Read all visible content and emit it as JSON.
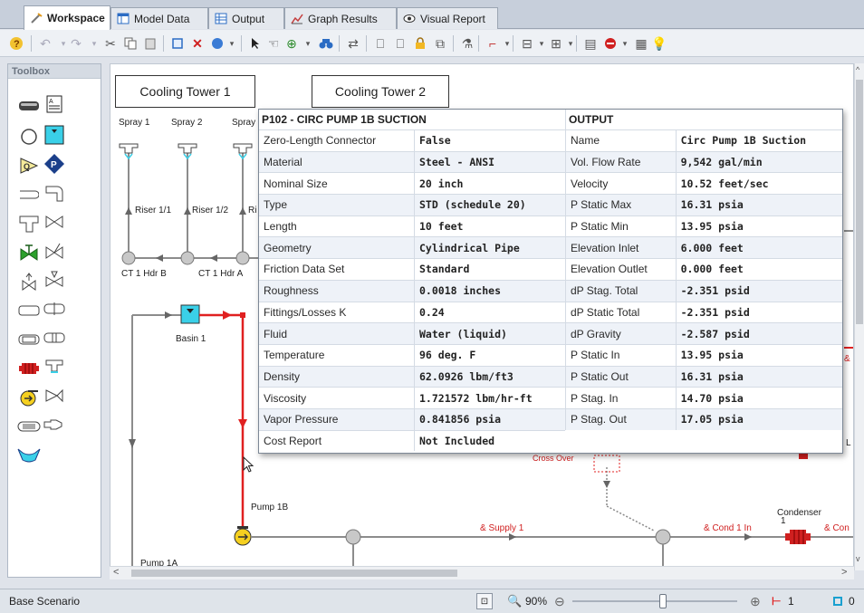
{
  "tabs": [
    {
      "label": "Workspace",
      "icon": "workspace-icon"
    },
    {
      "label": "Model Data",
      "icon": "model-data-icon"
    },
    {
      "label": "Output",
      "icon": "output-icon"
    },
    {
      "label": "Graph Results",
      "icon": "graph-icon"
    },
    {
      "label": "Visual Report",
      "icon": "eye-icon"
    }
  ],
  "toolbox": {
    "title": "Toolbox"
  },
  "workspace": {
    "cooling_tower_1": "Cooling Tower 1",
    "cooling_tower_2": "Cooling Tower 2",
    "labels": {
      "spray1": "Spray 1",
      "spray2": "Spray 2",
      "spray3": "Spray",
      "riser11": "Riser 1/1",
      "riser12": "Riser 1/2",
      "riser13": "Ri",
      "hdr_b": "CT 1 Hdr B",
      "hdr_a": "CT 1 Hdr A",
      "basin1": "Basin 1",
      "pump1b": "Pump 1B",
      "pump1a": "Pump 1A",
      "supply1": "& Supply 1",
      "cond1in": "& Cond 1 In",
      "condenser": "Condenser",
      "condenser_num": "1",
      "con": "& Con",
      "crossover": "Cross Over",
      "edge_l": "L",
      "edge_amp": "& C"
    }
  },
  "popup": {
    "left_header": "P102 - CIRC PUMP 1B SUCTION",
    "right_header": "OUTPUT",
    "left_rows": [
      {
        "k": "Zero-Length Connector",
        "v": "False"
      },
      {
        "k": "Material",
        "v": "Steel - ANSI"
      },
      {
        "k": "Nominal Size",
        "v": "20 inch"
      },
      {
        "k": "Type",
        "v": "STD (schedule 20)"
      },
      {
        "k": "Length",
        "v": "10 feet"
      },
      {
        "k": "Geometry",
        "v": "Cylindrical Pipe"
      },
      {
        "k": "Friction Data Set",
        "v": "Standard"
      },
      {
        "k": "Roughness",
        "v": "0.0018 inches"
      },
      {
        "k": "Fittings/Losses K",
        "v": "0.24"
      },
      {
        "k": "Fluid",
        "v": "Water (liquid)"
      },
      {
        "k": "Temperature",
        "v": "96 deg. F"
      },
      {
        "k": "Density",
        "v": "62.0926 lbm/ft3"
      },
      {
        "k": "Viscosity",
        "v": "1.721572 lbm/hr-ft"
      },
      {
        "k": "Vapor Pressure",
        "v": "0.841856 psia"
      },
      {
        "k": "Cost Report",
        "v": "Not Included"
      }
    ],
    "right_rows": [
      {
        "k": "Name",
        "v": "Circ Pump 1B Suction"
      },
      {
        "k": "Vol. Flow Rate",
        "v": "9,542 gal/min"
      },
      {
        "k": "Velocity",
        "v": "10.52 feet/sec"
      },
      {
        "k": "P Static Max",
        "v": "16.31 psia"
      },
      {
        "k": "P Static Min",
        "v": "13.95 psia"
      },
      {
        "k": "Elevation Inlet",
        "v": "6.000 feet"
      },
      {
        "k": "Elevation Outlet",
        "v": "0.000 feet"
      },
      {
        "k": "dP Stag. Total",
        "v": "-2.351 psid"
      },
      {
        "k": "dP Static Total",
        "v": "-2.351 psid"
      },
      {
        "k": "dP Gravity",
        "v": "-2.587 psid"
      },
      {
        "k": "P Static In",
        "v": "13.95 psia"
      },
      {
        "k": "P Static Out",
        "v": "16.31 psia"
      },
      {
        "k": "P Stag. In",
        "v": "14.70 psia"
      },
      {
        "k": "P Stag. Out",
        "v": "17.05 psia"
      }
    ]
  },
  "status": {
    "scenario": "Base Scenario",
    "zoom": "90%",
    "zoom_level": 0.55,
    "pipe_count": "1",
    "junction_count": "0"
  },
  "colors": {
    "selected_pipe": "#e02020",
    "pipe": "#8c8c8c",
    "accent": "#1a4fa0"
  }
}
